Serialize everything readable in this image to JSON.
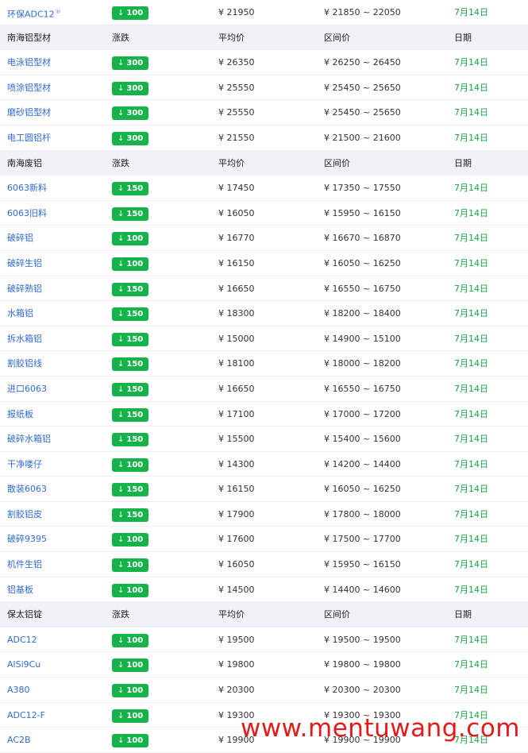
{
  "rows": [
    {
      "type": "item",
      "name": "环保ADC12",
      "mark": "®",
      "chg": "100",
      "avg": "¥ 21950",
      "range": "¥ 21850 ~ 22050",
      "date": "7月14日"
    },
    {
      "type": "header",
      "name": "南海铝型材",
      "chg": "涨跌",
      "avg": "平均价",
      "range": "区间价",
      "date": "日期"
    },
    {
      "type": "item",
      "name": "电泳铝型材",
      "chg": "300",
      "avg": "¥ 26350",
      "range": "¥ 26250 ~ 26450",
      "date": "7月14日"
    },
    {
      "type": "item",
      "name": "喷涂铝型材",
      "chg": "300",
      "avg": "¥ 25550",
      "range": "¥ 25450 ~ 25650",
      "date": "7月14日"
    },
    {
      "type": "item",
      "name": "磨砂铝型材",
      "chg": "300",
      "avg": "¥ 25550",
      "range": "¥ 25450 ~ 25650",
      "date": "7月14日"
    },
    {
      "type": "item",
      "name": "电工圆铝杆",
      "chg": "300",
      "avg": "¥ 21550",
      "range": "¥ 21500 ~ 21600",
      "date": "7月14日"
    },
    {
      "type": "header",
      "name": "南海废铝",
      "chg": "涨跌",
      "avg": "平均价",
      "range": "区间价",
      "date": "日期"
    },
    {
      "type": "item",
      "name": "6063新料",
      "chg": "150",
      "avg": "¥ 17450",
      "range": "¥ 17350 ~ 17550",
      "date": "7月14日"
    },
    {
      "type": "item",
      "name": "6063旧料",
      "chg": "150",
      "avg": "¥ 16050",
      "range": "¥ 15950 ~ 16150",
      "date": "7月14日"
    },
    {
      "type": "item",
      "name": "破碎铝",
      "chg": "100",
      "avg": "¥ 16770",
      "range": "¥ 16670 ~ 16870",
      "date": "7月14日"
    },
    {
      "type": "item",
      "name": "破碎生铝",
      "chg": "100",
      "avg": "¥ 16150",
      "range": "¥ 16050 ~ 16250",
      "date": "7月14日"
    },
    {
      "type": "item",
      "name": "破碎熟铝",
      "chg": "150",
      "avg": "¥ 16650",
      "range": "¥ 16550 ~ 16750",
      "date": "7月14日"
    },
    {
      "type": "item",
      "name": "水箱铝",
      "chg": "150",
      "avg": "¥ 18300",
      "range": "¥ 18200 ~ 18400",
      "date": "7月14日"
    },
    {
      "type": "item",
      "name": "拆水箱铝",
      "chg": "150",
      "avg": "¥ 15000",
      "range": "¥ 14900 ~ 15100",
      "date": "7月14日"
    },
    {
      "type": "item",
      "name": "割胶铝线",
      "chg": "150",
      "avg": "¥ 18100",
      "range": "¥ 18000 ~ 18200",
      "date": "7月14日"
    },
    {
      "type": "item",
      "name": "进口6063",
      "chg": "150",
      "avg": "¥ 16650",
      "range": "¥ 16550 ~ 16750",
      "date": "7月14日"
    },
    {
      "type": "item",
      "name": "报纸板",
      "chg": "150",
      "avg": "¥ 17100",
      "range": "¥ 17000 ~ 17200",
      "date": "7月14日"
    },
    {
      "type": "item",
      "name": "破碎水箱铝",
      "chg": "150",
      "avg": "¥ 15500",
      "range": "¥ 15400 ~ 15600",
      "date": "7月14日"
    },
    {
      "type": "item",
      "name": "干净喽仔",
      "chg": "100",
      "avg": "¥ 14300",
      "range": "¥ 14200 ~ 14400",
      "date": "7月14日"
    },
    {
      "type": "item",
      "name": "散装6063",
      "chg": "150",
      "avg": "¥ 16150",
      "range": "¥ 16050 ~ 16250",
      "date": "7月14日"
    },
    {
      "type": "item",
      "name": "割胶铝皮",
      "chg": "150",
      "avg": "¥ 17900",
      "range": "¥ 17800 ~ 18000",
      "date": "7月14日"
    },
    {
      "type": "item",
      "name": "破碎9395",
      "chg": "100",
      "avg": "¥ 17600",
      "range": "¥ 17500 ~ 17700",
      "date": "7月14日"
    },
    {
      "type": "item",
      "name": "机件生铝",
      "chg": "100",
      "avg": "¥ 16050",
      "range": "¥ 15950 ~ 16150",
      "date": "7月14日"
    },
    {
      "type": "item",
      "name": "铝基板",
      "chg": "100",
      "avg": "¥ 14500",
      "range": "¥ 14400 ~ 14600",
      "date": "7月14日"
    },
    {
      "type": "header",
      "name": "保太铝锭",
      "chg": "涨跌",
      "avg": "平均价",
      "range": "区间价",
      "date": "日期"
    },
    {
      "type": "item",
      "name": "ADC12",
      "chg": "100",
      "avg": "¥ 19500",
      "range": "¥ 19500 ~ 19500",
      "date": "7月14日"
    },
    {
      "type": "item",
      "name": "AlSi9Cu",
      "chg": "100",
      "avg": "¥ 19800",
      "range": "¥ 19800 ~ 19800",
      "date": "7月14日"
    },
    {
      "type": "item",
      "name": "A380",
      "chg": "100",
      "avg": "¥ 20300",
      "range": "¥ 20300 ~ 20300",
      "date": "7月14日"
    },
    {
      "type": "item",
      "name": "ADC12-F",
      "chg": "100",
      "avg": "¥ 19300",
      "range": "¥ 19300 ~ 19300",
      "date": "7月14日"
    },
    {
      "type": "item",
      "name": "AC2B",
      "chg": "100",
      "avg": "¥ 19900",
      "range": "¥ 19900 ~ 19900",
      "date": "7月14日"
    }
  ],
  "down_arrow": "↓",
  "brand": "www.mentuwang.com",
  "colors": {
    "badge": "#16b34b",
    "link": "#2f6bd3",
    "date": "#1aa34a",
    "header_bg": "#f1f1f8",
    "brand": "#e11a1a"
  }
}
